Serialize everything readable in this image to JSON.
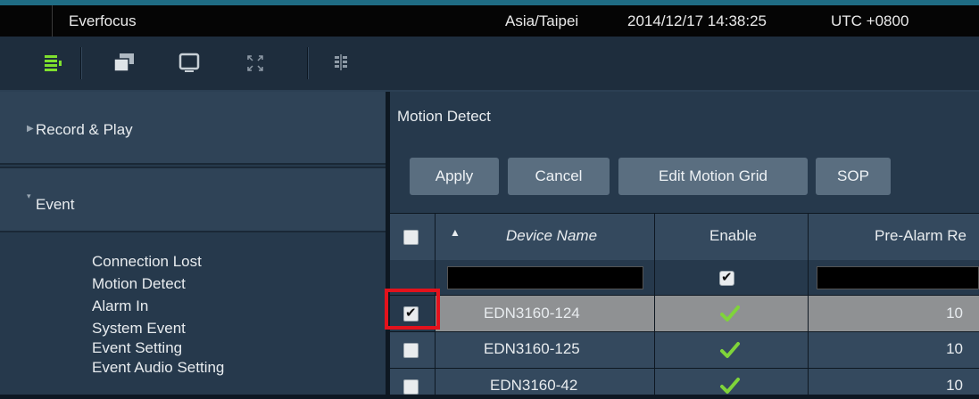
{
  "titlebar": {
    "app_name": "Everfocus",
    "timezone": "Asia/Taipei",
    "datetime": "2014/12/17 14:38:25",
    "utc_offset": "UTC +0800"
  },
  "toolbar": {
    "icons": [
      "menu-list-icon",
      "windows-icon",
      "monitor-icon",
      "fullscreen-icon",
      "layout-grid-icon"
    ]
  },
  "sidebar": {
    "sections": [
      {
        "label": "Record & Play",
        "expanded": false
      },
      {
        "label": "Event",
        "expanded": true
      }
    ],
    "event_items": [
      "Connection Lost",
      "Motion Detect",
      "Alarm In",
      "System Event",
      "Event Setting",
      "Event Audio Setting"
    ]
  },
  "main": {
    "title": "Motion Detect",
    "buttons": [
      "Apply",
      "Cancel",
      "Edit Motion Grid",
      "SOP"
    ],
    "table": {
      "columns": [
        "Device Name",
        "Enable",
        "Pre-Alarm Re"
      ],
      "sort_column": "Device Name",
      "sort_direction": "ascending",
      "filter_row": {
        "device_name": "",
        "enable_checked": true,
        "pre_alarm": ""
      },
      "rows": [
        {
          "selected": true,
          "device_name": "EDN3160-124",
          "enable": true,
          "pre_alarm": "10"
        },
        {
          "selected": false,
          "device_name": "EDN3160-125",
          "enable": true,
          "pre_alarm": "10"
        },
        {
          "selected": false,
          "device_name": "EDN3160-42",
          "enable": true,
          "pre_alarm": "10"
        }
      ]
    }
  },
  "colors": {
    "accent_line": "#1f6c84",
    "highlight_border": "#e3121c",
    "check_green": "#7fd43a",
    "selected_row": "#8f9193"
  }
}
